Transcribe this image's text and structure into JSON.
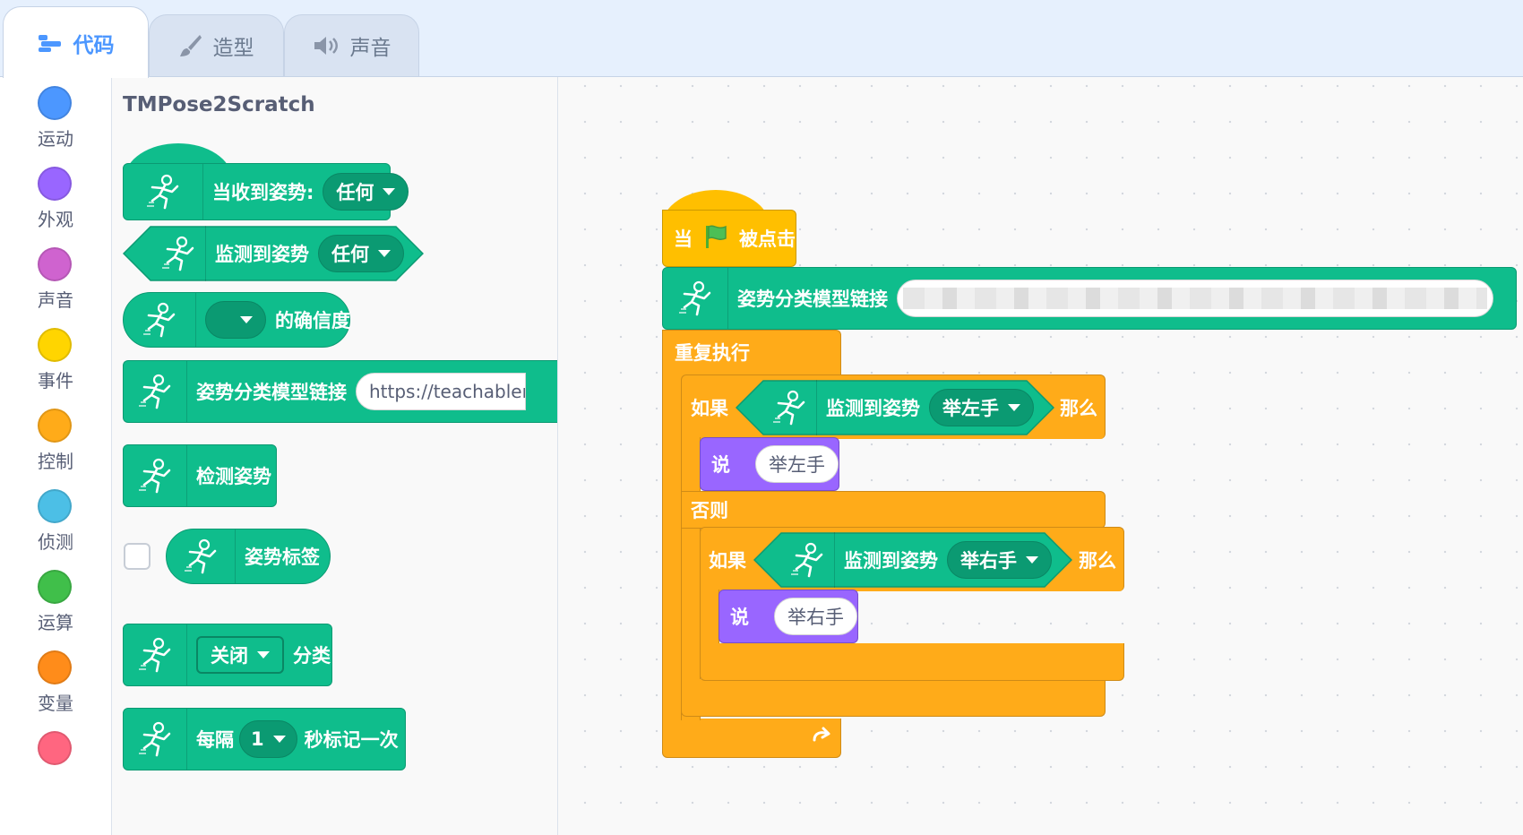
{
  "tabs": [
    {
      "label": "代码",
      "icon": "code-icon",
      "active": true
    },
    {
      "label": "造型",
      "icon": "brush-icon",
      "active": false
    },
    {
      "label": "声音",
      "icon": "speaker-icon",
      "active": false
    }
  ],
  "categories": [
    {
      "label": "运动",
      "color": "#4c97ff"
    },
    {
      "label": "外观",
      "color": "#9966ff"
    },
    {
      "label": "声音",
      "color": "#cf63cf"
    },
    {
      "label": "事件",
      "color": "#ffd500"
    },
    {
      "label": "控制",
      "color": "#ffab19"
    },
    {
      "label": "侦测",
      "color": "#4cbfe6"
    },
    {
      "label": "运算",
      "color": "#40bf4a"
    },
    {
      "label": "变量",
      "color": "#ff8c1a"
    },
    {
      "label": "",
      "color": "#ff6680"
    }
  ],
  "flyout": {
    "title": "TMPose2Scratch",
    "when_received_label": "当收到姿势:",
    "when_received_value": "任何",
    "detected_label": "监测到姿势",
    "detected_value": "任何",
    "confidence_label": "的确信度",
    "model_url_label": "姿势分类模型链接",
    "model_url_value": "https://teachablem",
    "detect_label": "检测姿势",
    "pose_label_reporter": "姿势标签",
    "classify_value": "关闭",
    "classify_label": "分类",
    "every_label": "每隔",
    "every_value": "1",
    "every_suffix": "秒标记一次"
  },
  "script": {
    "when_label": "当",
    "clicked_label": "被点击",
    "model_url_label": "姿势分类模型链接",
    "forever_label": "重复执行",
    "if_label": "如果",
    "then_label": "那么",
    "else_label": "否则",
    "detected_label": "监测到姿势",
    "pose_left": "举左手",
    "pose_right": "举右手",
    "say_label": "说",
    "say_left": "举左手",
    "say_right": "举右手"
  },
  "colors": {
    "extension": "#0fbd8c",
    "control": "#ffab19",
    "looks": "#9966ff",
    "events": "#ffbf00",
    "accent": "#4c97ff"
  }
}
